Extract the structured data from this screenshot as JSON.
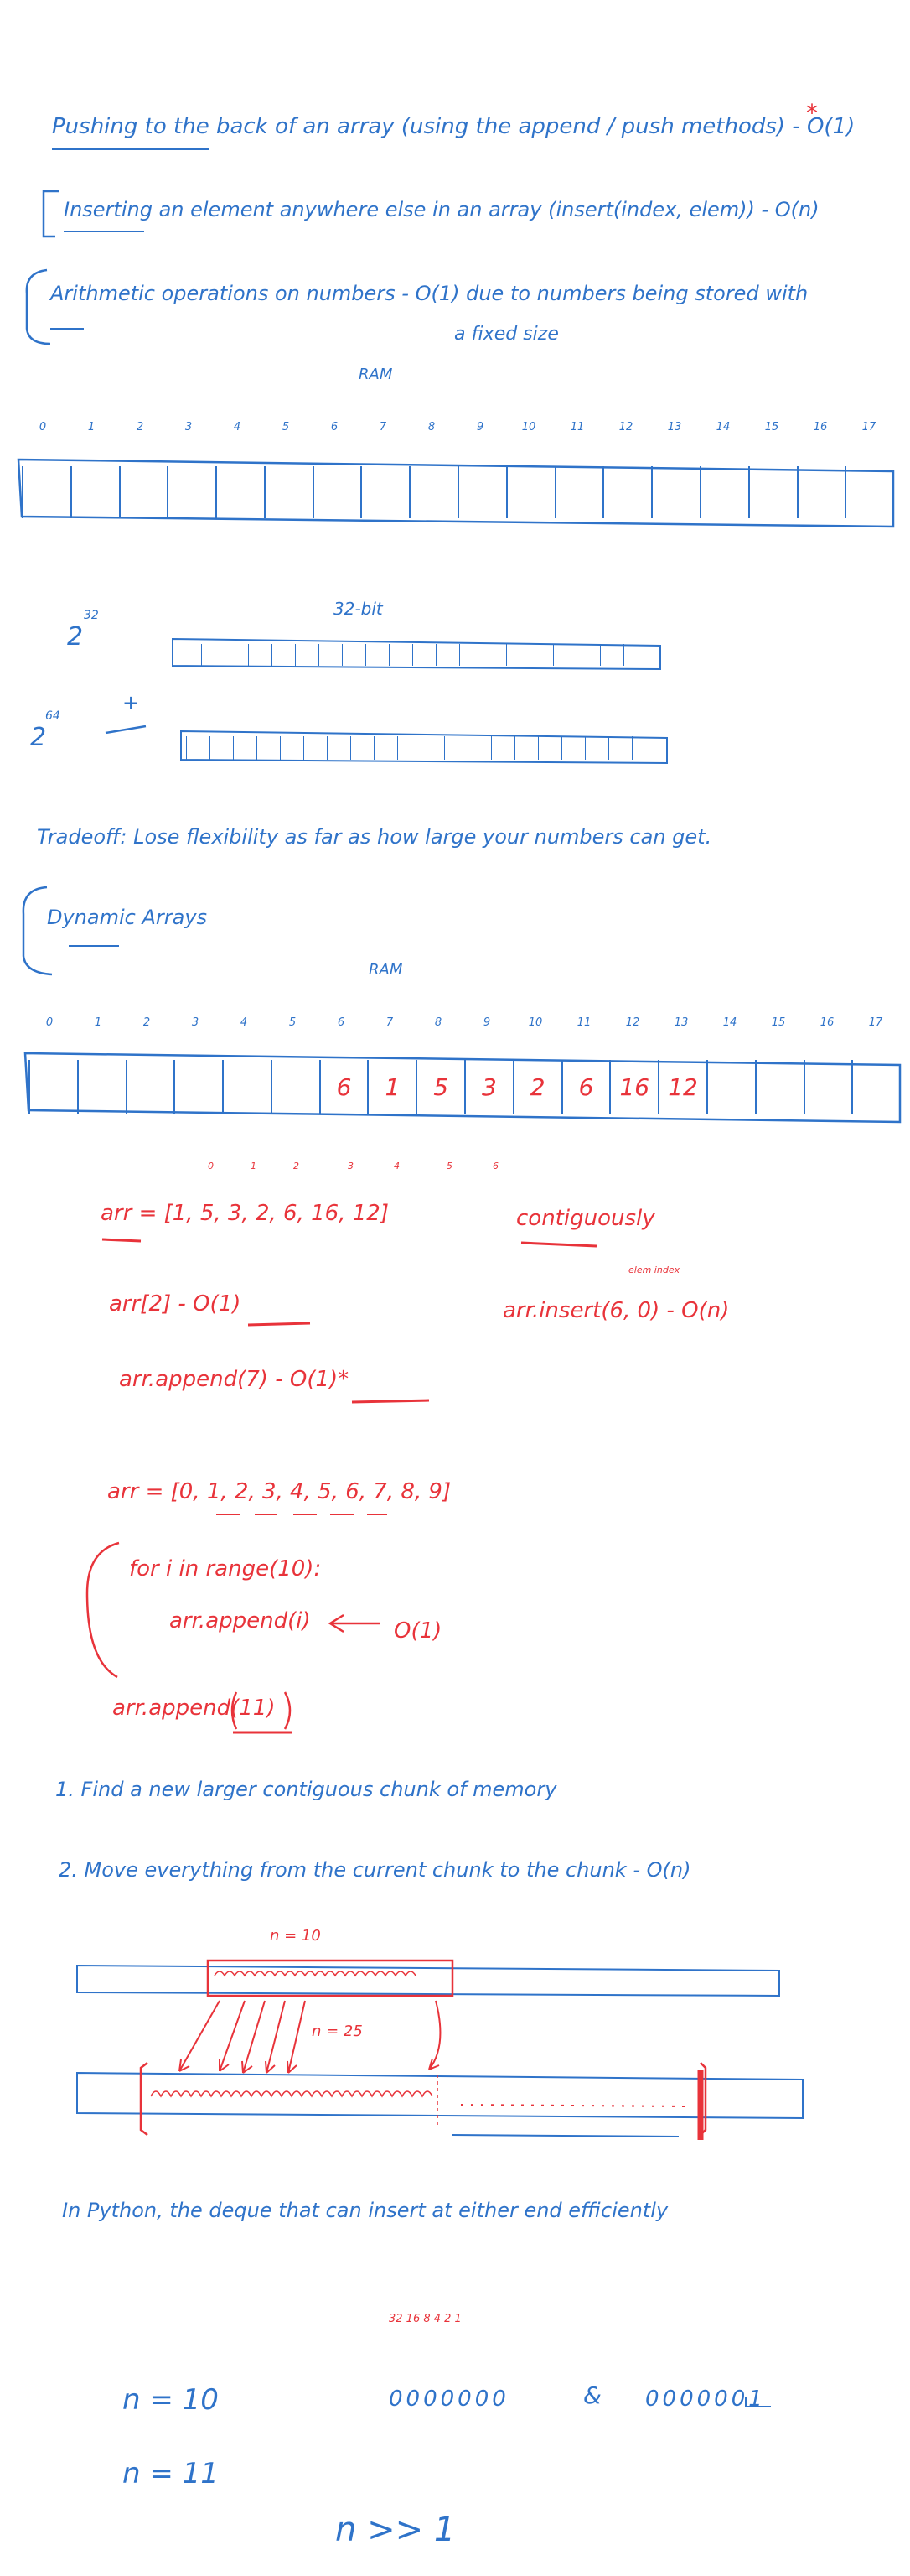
{
  "notes": {
    "push_back": "Pushing to the back of an array (using the append / push methods) - O(1)",
    "push_back_star": "*",
    "insert_else": "Inserting an element anywhere else in an array (insert(index, elem)) - O(n)",
    "arith_line1": "Arithmetic operations on numbers - O(1) due to numbers being stored with",
    "arith_line2": "a fixed size",
    "tradeoff": "Tradeoff: Lose flexibility as far as how large your numbers can get.",
    "dynamic_title": "Dynamic Arrays",
    "step1": "1. Find a new larger contiguous chunk of memory",
    "step2": "2. Move everything from the current chunk to the chunk - O(n)",
    "python_deque": "In Python, the deque that can insert at either end efficiently"
  },
  "ram1": {
    "label": "RAM",
    "indices": [
      "0",
      "1",
      "2",
      "3",
      "4",
      "5",
      "6",
      "7",
      "8",
      "9",
      "10",
      "11",
      "12",
      "13",
      "14",
      "15",
      "16",
      "17"
    ]
  },
  "bits": {
    "label": "32-bit",
    "exp_32": "2",
    "exp_32_sup": "32",
    "exp_64": "2",
    "exp_64_sup": "64",
    "plus": "+"
  },
  "ram2": {
    "label": "RAM",
    "indices": [
      "0",
      "1",
      "2",
      "3",
      "4",
      "5",
      "6",
      "7",
      "8",
      "9",
      "10",
      "11",
      "12",
      "13",
      "14",
      "15",
      "16",
      "17"
    ],
    "values": [
      "",
      "",
      "",
      "",
      "",
      "",
      "6",
      "1",
      "5",
      "3",
      "2",
      "6",
      "16",
      "12",
      "",
      "",
      "",
      ""
    ]
  },
  "code": {
    "arr_indices": [
      "0",
      "1",
      "2",
      "3",
      "4",
      "5",
      "6"
    ],
    "arr_def": "arr = [1, 5, 3, 2, 6, 16, 12]",
    "contiguously": "contiguously",
    "arr_access": "arr[2]  - O(1)",
    "insert_labels": "elem  index",
    "arr_insert": "arr.insert(6, 0) - O(n)",
    "arr_append7": "arr.append(7)  - O(1)*",
    "arr_range": "arr = [0, 1, 2, 3, 4, 5, 6, 7, 8, 9]",
    "for_loop": "for i in range(10):",
    "loop_body": "arr.append(i)",
    "loop_cost": "O(1)",
    "append11": "arr.append(11)"
  },
  "diagram": {
    "n10": "n = 10",
    "n25": "n = 25"
  },
  "binary": {
    "place_values": "32 16 8 4 2 1",
    "n10": "n = 10",
    "zeros": "0000000",
    "amp": "&",
    "one": "0000001",
    "n11": "n = 11",
    "n_gg_1": "n >> 1"
  },
  "colors": {
    "blue": "#2f73c9",
    "red": "#e8333a"
  }
}
